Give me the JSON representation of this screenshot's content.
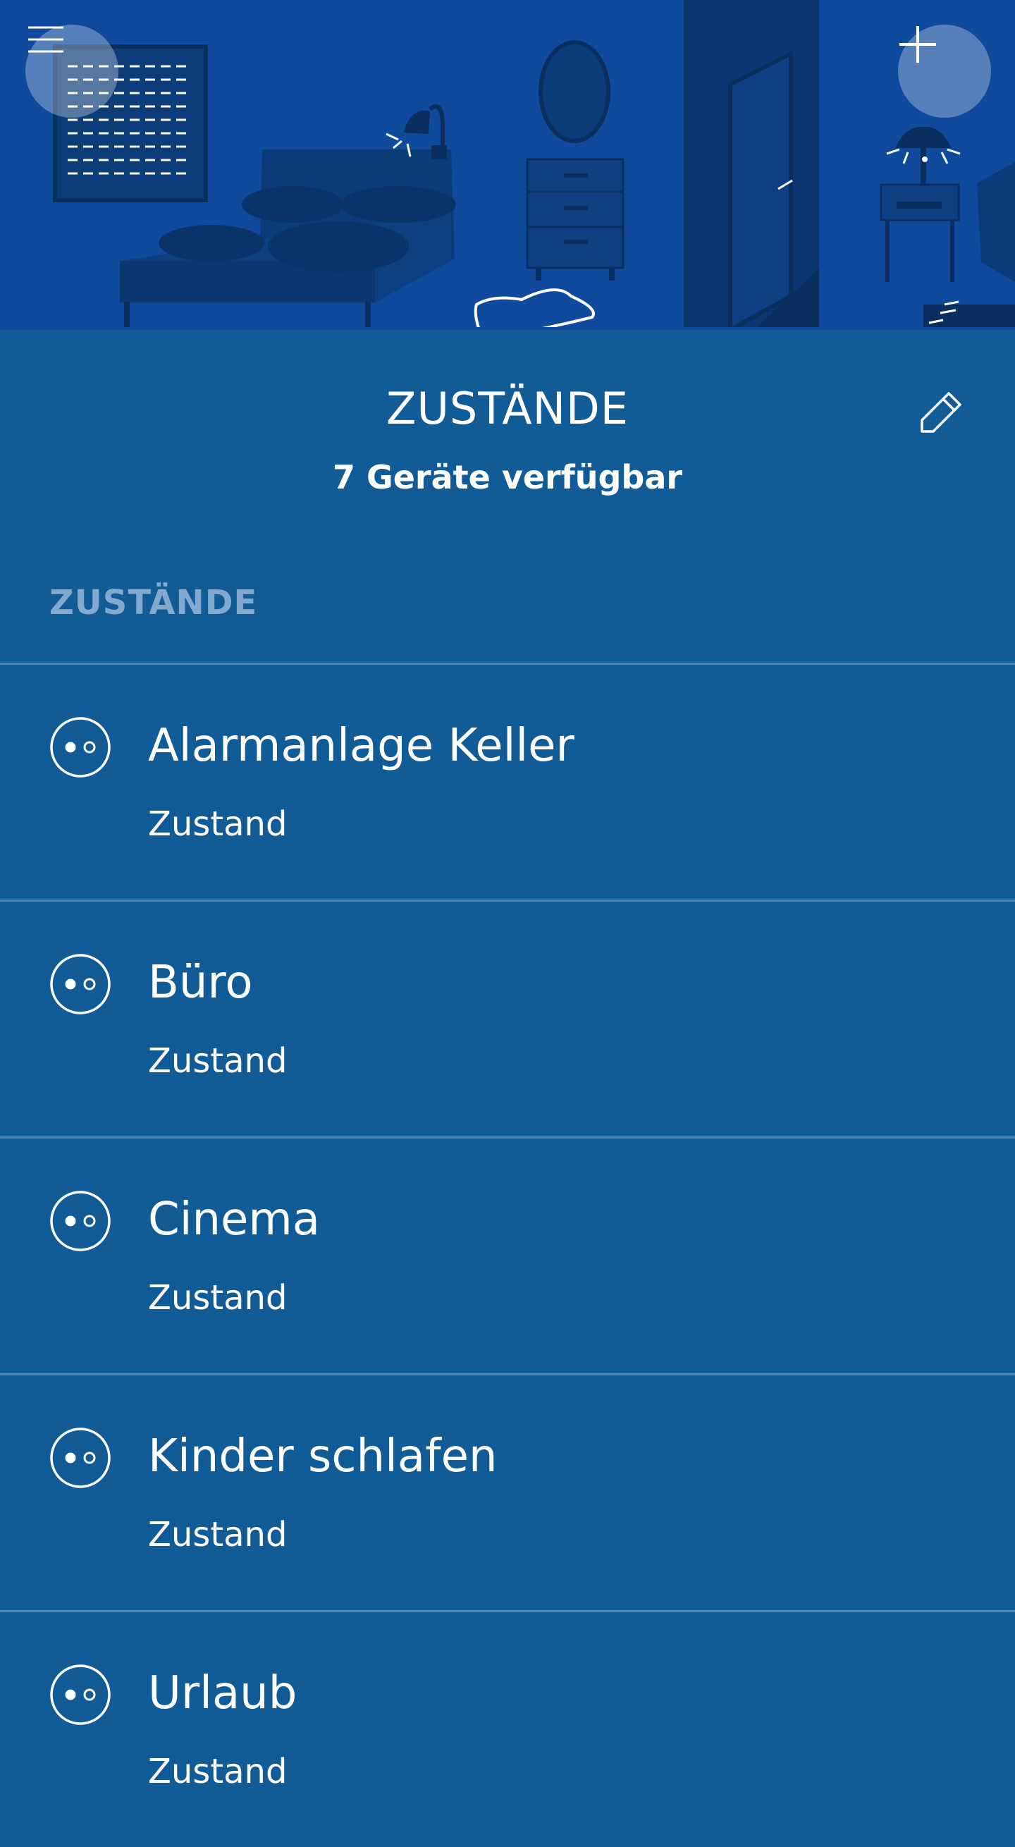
{
  "header": {
    "title": "ZUSTÄNDE",
    "subtitle": "7 Geräte verfügbar",
    "menu_icon": "hamburger-menu-icon",
    "add_icon": "plus-icon",
    "edit_icon": "pencil-icon"
  },
  "section": {
    "label": "ZUSTÄNDE"
  },
  "states": [
    {
      "name": "Alarmanlage Keller",
      "subtitle": "Zustand",
      "icon": "state-toggle-icon"
    },
    {
      "name": "Büro",
      "subtitle": "Zustand",
      "icon": "state-toggle-icon"
    },
    {
      "name": "Cinema",
      "subtitle": "Zustand",
      "icon": "state-toggle-icon"
    },
    {
      "name": "Kinder schlafen",
      "subtitle": "Zustand",
      "icon": "state-toggle-icon"
    },
    {
      "name": "Urlaub",
      "subtitle": "Zustand",
      "icon": "state-toggle-icon"
    }
  ],
  "colors": {
    "hero_background": "#0f4a9c",
    "page_background": "#115b96",
    "section_label": "#83a9cf",
    "divider": "#4f86b8",
    "text": "#ffffff"
  }
}
